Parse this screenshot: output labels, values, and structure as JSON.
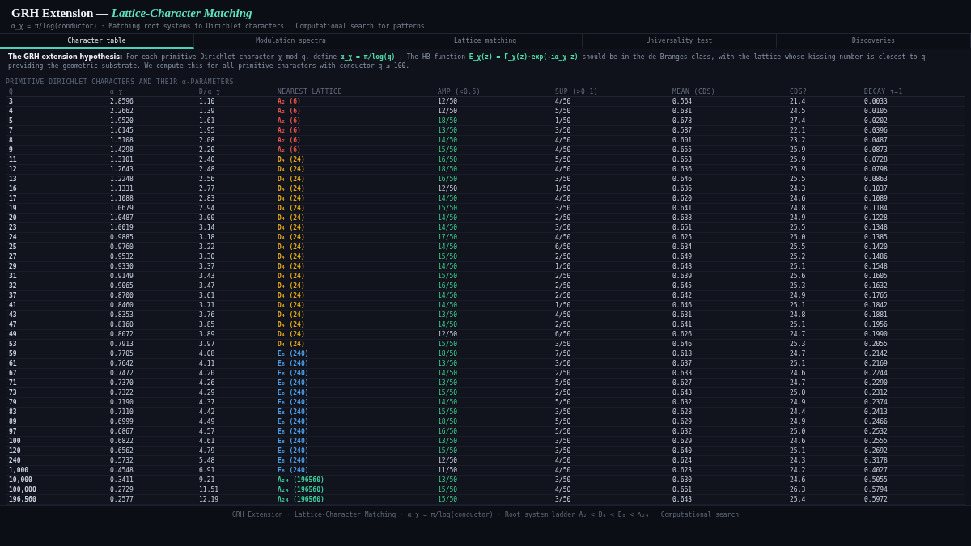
{
  "header": {
    "title": "GRH Extension — ",
    "title_em": "Lattice-Character Matching",
    "subtitle": "α_χ = π/log(conductor) · Matching root systems to Dirichlet characters · Computational search for patterns"
  },
  "tabs": [
    {
      "label": "Character table",
      "selected": true
    },
    {
      "label": "Modulation spectra",
      "selected": false
    },
    {
      "label": "Lattice matching",
      "selected": false
    },
    {
      "label": "Universality test",
      "selected": false
    },
    {
      "label": "Discoveries",
      "selected": false
    }
  ],
  "intro": [
    {
      "kind": "lead",
      "text": "The GRH extension hypothesis:"
    },
    {
      "kind": "text",
      "text": "For each primitive Dirichlet character χ mod q, define"
    },
    {
      "kind": "code",
      "text": "α_χ = π/log(q)"
    },
    {
      "kind": "text",
      "text": ". The HB function"
    },
    {
      "kind": "code",
      "text": "E_χ(z) = Γ_χ(z)·exp(-iα_χ z)"
    },
    {
      "kind": "text",
      "text": "should be in the de Branges class, with the lattice whose kissing number is closest to q providing the geometric substrate. We compute this for all primitive characters with conductor q ≤ 100."
    }
  ],
  "section_label": "PRIMITIVE DIRICHLET CHARACTERS AND THEIR α-PARAMETERS",
  "table": {
    "columns": [
      "Q",
      "α_χ",
      "D/α_χ",
      "NEAREST LATTICE",
      "AMP (<0.5)",
      "SUP (>0.1)",
      "MEAN (CDS)",
      "CDS?",
      "DECAY τ=1"
    ],
    "rows": [
      {
        "q": "3",
        "alpha": "2.8596",
        "d_alpha": "1.10",
        "lattice": {
          "symbol": "A₂",
          "kissing": "(6)",
          "color": "#e5534b"
        },
        "amp": "12/50",
        "amp_pass": false,
        "sup": "4/50",
        "mean": "0.564",
        "cds": "21.4",
        "decay": "0.0033"
      },
      {
        "q": "4",
        "alpha": "2.2662",
        "d_alpha": "1.39",
        "lattice": {
          "symbol": "A₂",
          "kissing": "(6)",
          "color": "#e5534b"
        },
        "amp": "12/50",
        "amp_pass": false,
        "sup": "5/50",
        "mean": "0.631",
        "cds": "24.5",
        "decay": "0.0105"
      },
      {
        "q": "5",
        "alpha": "1.9520",
        "d_alpha": "1.61",
        "lattice": {
          "symbol": "A₂",
          "kissing": "(6)",
          "color": "#e5534b"
        },
        "amp": "18/50",
        "amp_pass": true,
        "sup": "1/50",
        "mean": "0.678",
        "cds": "27.4",
        "decay": "0.0202"
      },
      {
        "q": "7",
        "alpha": "1.6145",
        "d_alpha": "1.95",
        "lattice": {
          "symbol": "A₂",
          "kissing": "(6)",
          "color": "#e5534b"
        },
        "amp": "13/50",
        "amp_pass": true,
        "sup": "3/50",
        "mean": "0.587",
        "cds": "22.1",
        "decay": "0.0396"
      },
      {
        "q": "8",
        "alpha": "1.5108",
        "d_alpha": "2.08",
        "lattice": {
          "symbol": "A₂",
          "kissing": "(6)",
          "color": "#e5534b"
        },
        "amp": "14/50",
        "amp_pass": true,
        "sup": "4/50",
        "mean": "0.601",
        "cds": "23.2",
        "decay": "0.0487"
      },
      {
        "q": "9",
        "alpha": "1.4298",
        "d_alpha": "2.20",
        "lattice": {
          "symbol": "A₂",
          "kissing": "(6)",
          "color": "#e5534b"
        },
        "amp": "15/50",
        "amp_pass": true,
        "sup": "4/50",
        "mean": "0.655",
        "cds": "25.9",
        "decay": "0.0873"
      },
      {
        "q": "11",
        "alpha": "1.3101",
        "d_alpha": "2.40",
        "lattice": {
          "symbol": "D₄",
          "kissing": "(24)",
          "color": "#e6a817"
        },
        "amp": "16/50",
        "amp_pass": true,
        "sup": "5/50",
        "mean": "0.653",
        "cds": "25.9",
        "decay": "0.0728"
      },
      {
        "q": "12",
        "alpha": "1.2643",
        "d_alpha": "2.48",
        "lattice": {
          "symbol": "D₄",
          "kissing": "(24)",
          "color": "#e6a817"
        },
        "amp": "18/50",
        "amp_pass": true,
        "sup": "4/50",
        "mean": "0.636",
        "cds": "25.9",
        "decay": "0.0798"
      },
      {
        "q": "13",
        "alpha": "1.2248",
        "d_alpha": "2.56",
        "lattice": {
          "symbol": "D₄",
          "kissing": "(24)",
          "color": "#e6a817"
        },
        "amp": "16/50",
        "amp_pass": true,
        "sup": "3/50",
        "mean": "0.646",
        "cds": "25.5",
        "decay": "0.0863"
      },
      {
        "q": "16",
        "alpha": "1.1331",
        "d_alpha": "2.77",
        "lattice": {
          "symbol": "D₄",
          "kissing": "(24)",
          "color": "#e6a817"
        },
        "amp": "12/50",
        "amp_pass": false,
        "sup": "1/50",
        "mean": "0.636",
        "cds": "24.3",
        "decay": "0.1037"
      },
      {
        "q": "17",
        "alpha": "1.1088",
        "d_alpha": "2.83",
        "lattice": {
          "symbol": "D₄",
          "kissing": "(24)",
          "color": "#e6a817"
        },
        "amp": "14/50",
        "amp_pass": true,
        "sup": "4/50",
        "mean": "0.620",
        "cds": "24.6",
        "decay": "0.1089"
      },
      {
        "q": "19",
        "alpha": "1.0679",
        "d_alpha": "2.94",
        "lattice": {
          "symbol": "D₄",
          "kissing": "(24)",
          "color": "#e6a817"
        },
        "amp": "15/50",
        "amp_pass": true,
        "sup": "3/50",
        "mean": "0.641",
        "cds": "24.8",
        "decay": "0.1184"
      },
      {
        "q": "20",
        "alpha": "1.0487",
        "d_alpha": "3.00",
        "lattice": {
          "symbol": "D₄",
          "kissing": "(24)",
          "color": "#e6a817"
        },
        "amp": "14/50",
        "amp_pass": true,
        "sup": "2/50",
        "mean": "0.638",
        "cds": "24.9",
        "decay": "0.1228"
      },
      {
        "q": "23",
        "alpha": "1.0019",
        "d_alpha": "3.14",
        "lattice": {
          "symbol": "D₄",
          "kissing": "(24)",
          "color": "#e6a817"
        },
        "amp": "14/50",
        "amp_pass": true,
        "sup": "3/50",
        "mean": "0.651",
        "cds": "25.5",
        "decay": "0.1348"
      },
      {
        "q": "24",
        "alpha": "0.9885",
        "d_alpha": "3.18",
        "lattice": {
          "symbol": "D₄",
          "kissing": "(24)",
          "color": "#e6a817"
        },
        "amp": "17/50",
        "amp_pass": true,
        "sup": "4/50",
        "mean": "0.625",
        "cds": "25.0",
        "decay": "0.1385"
      },
      {
        "q": "25",
        "alpha": "0.9760",
        "d_alpha": "3.22",
        "lattice": {
          "symbol": "D₄",
          "kissing": "(24)",
          "color": "#e6a817"
        },
        "amp": "14/50",
        "amp_pass": true,
        "sup": "6/50",
        "mean": "0.634",
        "cds": "25.5",
        "decay": "0.1420"
      },
      {
        "q": "27",
        "alpha": "0.9532",
        "d_alpha": "3.30",
        "lattice": {
          "symbol": "D₄",
          "kissing": "(24)",
          "color": "#e6a817"
        },
        "amp": "15/50",
        "amp_pass": true,
        "sup": "2/50",
        "mean": "0.649",
        "cds": "25.2",
        "decay": "0.1486"
      },
      {
        "q": "29",
        "alpha": "0.9330",
        "d_alpha": "3.37",
        "lattice": {
          "symbol": "D₄",
          "kissing": "(24)",
          "color": "#e6a817"
        },
        "amp": "14/50",
        "amp_pass": true,
        "sup": "1/50",
        "mean": "0.648",
        "cds": "25.1",
        "decay": "0.1548"
      },
      {
        "q": "31",
        "alpha": "0.9149",
        "d_alpha": "3.43",
        "lattice": {
          "symbol": "D₄",
          "kissing": "(24)",
          "color": "#e6a817"
        },
        "amp": "15/50",
        "amp_pass": true,
        "sup": "2/50",
        "mean": "0.639",
        "cds": "25.6",
        "decay": "0.1605"
      },
      {
        "q": "32",
        "alpha": "0.9065",
        "d_alpha": "3.47",
        "lattice": {
          "symbol": "D₄",
          "kissing": "(24)",
          "color": "#e6a817"
        },
        "amp": "16/50",
        "amp_pass": true,
        "sup": "2/50",
        "mean": "0.645",
        "cds": "25.3",
        "decay": "0.1632"
      },
      {
        "q": "37",
        "alpha": "0.8700",
        "d_alpha": "3.61",
        "lattice": {
          "symbol": "D₄",
          "kissing": "(24)",
          "color": "#e6a817"
        },
        "amp": "14/50",
        "amp_pass": true,
        "sup": "2/50",
        "mean": "0.642",
        "cds": "24.9",
        "decay": "0.1765"
      },
      {
        "q": "41",
        "alpha": "0.8460",
        "d_alpha": "3.71",
        "lattice": {
          "symbol": "D₄",
          "kissing": "(24)",
          "color": "#e6a817"
        },
        "amp": "14/50",
        "amp_pass": true,
        "sup": "1/50",
        "mean": "0.646",
        "cds": "25.1",
        "decay": "0.1842"
      },
      {
        "q": "43",
        "alpha": "0.8353",
        "d_alpha": "3.76",
        "lattice": {
          "symbol": "D₄",
          "kissing": "(24)",
          "color": "#e6a817"
        },
        "amp": "13/50",
        "amp_pass": true,
        "sup": "4/50",
        "mean": "0.631",
        "cds": "24.8",
        "decay": "0.1881"
      },
      {
        "q": "47",
        "alpha": "0.8160",
        "d_alpha": "3.85",
        "lattice": {
          "symbol": "D₄",
          "kissing": "(24)",
          "color": "#e6a817"
        },
        "amp": "14/50",
        "amp_pass": true,
        "sup": "2/50",
        "mean": "0.641",
        "cds": "25.1",
        "decay": "0.1956"
      },
      {
        "q": "49",
        "alpha": "0.8072",
        "d_alpha": "3.89",
        "lattice": {
          "symbol": "D₄",
          "kissing": "(24)",
          "color": "#e6a817"
        },
        "amp": "12/50",
        "amp_pass": false,
        "sup": "6/50",
        "mean": "0.626",
        "cds": "24.7",
        "decay": "0.1990"
      },
      {
        "q": "53",
        "alpha": "0.7913",
        "d_alpha": "3.97",
        "lattice": {
          "symbol": "D₄",
          "kissing": "(24)",
          "color": "#e6a817"
        },
        "amp": "15/50",
        "amp_pass": true,
        "sup": "3/50",
        "mean": "0.646",
        "cds": "25.3",
        "decay": "0.2055"
      },
      {
        "q": "59",
        "alpha": "0.7705",
        "d_alpha": "4.08",
        "lattice": {
          "symbol": "E₈",
          "kissing": "(240)",
          "color": "#4f9ee8"
        },
        "amp": "18/50",
        "amp_pass": true,
        "sup": "7/50",
        "mean": "0.618",
        "cds": "24.7",
        "decay": "0.2142"
      },
      {
        "q": "61",
        "alpha": "0.7642",
        "d_alpha": "4.11",
        "lattice": {
          "symbol": "E₈",
          "kissing": "(240)",
          "color": "#4f9ee8"
        },
        "amp": "13/50",
        "amp_pass": true,
        "sup": "3/50",
        "mean": "0.637",
        "cds": "25.1",
        "decay": "0.2169"
      },
      {
        "q": "67",
        "alpha": "0.7472",
        "d_alpha": "4.20",
        "lattice": {
          "symbol": "E₈",
          "kissing": "(240)",
          "color": "#4f9ee8"
        },
        "amp": "14/50",
        "amp_pass": true,
        "sup": "2/50",
        "mean": "0.633",
        "cds": "24.6",
        "decay": "0.2244"
      },
      {
        "q": "71",
        "alpha": "0.7370",
        "d_alpha": "4.26",
        "lattice": {
          "symbol": "E₈",
          "kissing": "(240)",
          "color": "#4f9ee8"
        },
        "amp": "13/50",
        "amp_pass": true,
        "sup": "5/50",
        "mean": "0.627",
        "cds": "24.7",
        "decay": "0.2290"
      },
      {
        "q": "73",
        "alpha": "0.7322",
        "d_alpha": "4.29",
        "lattice": {
          "symbol": "E₈",
          "kissing": "(240)",
          "color": "#4f9ee8"
        },
        "amp": "15/50",
        "amp_pass": true,
        "sup": "2/50",
        "mean": "0.643",
        "cds": "25.0",
        "decay": "0.2312"
      },
      {
        "q": "79",
        "alpha": "0.7190",
        "d_alpha": "4.37",
        "lattice": {
          "symbol": "E₈",
          "kissing": "(240)",
          "color": "#4f9ee8"
        },
        "amp": "14/50",
        "amp_pass": true,
        "sup": "5/50",
        "mean": "0.632",
        "cds": "24.9",
        "decay": "0.2374"
      },
      {
        "q": "83",
        "alpha": "0.7110",
        "d_alpha": "4.42",
        "lattice": {
          "symbol": "E₈",
          "kissing": "(240)",
          "color": "#4f9ee8"
        },
        "amp": "15/50",
        "amp_pass": true,
        "sup": "3/50",
        "mean": "0.628",
        "cds": "24.4",
        "decay": "0.2413"
      },
      {
        "q": "89",
        "alpha": "0.6999",
        "d_alpha": "4.49",
        "lattice": {
          "symbol": "E₈",
          "kissing": "(240)",
          "color": "#4f9ee8"
        },
        "amp": "18/50",
        "amp_pass": true,
        "sup": "5/50",
        "mean": "0.629",
        "cds": "24.9",
        "decay": "0.2466"
      },
      {
        "q": "97",
        "alpha": "0.6867",
        "d_alpha": "4.57",
        "lattice": {
          "symbol": "E₈",
          "kissing": "(240)",
          "color": "#4f9ee8"
        },
        "amp": "16/50",
        "amp_pass": true,
        "sup": "5/50",
        "mean": "0.632",
        "cds": "25.0",
        "decay": "0.2532"
      },
      {
        "q": "100",
        "alpha": "0.6822",
        "d_alpha": "4.61",
        "lattice": {
          "symbol": "E₈",
          "kissing": "(240)",
          "color": "#4f9ee8"
        },
        "amp": "13/50",
        "amp_pass": true,
        "sup": "3/50",
        "mean": "0.629",
        "cds": "24.6",
        "decay": "0.2555"
      },
      {
        "q": "120",
        "alpha": "0.6562",
        "d_alpha": "4.79",
        "lattice": {
          "symbol": "E₈",
          "kissing": "(240)",
          "color": "#4f9ee8"
        },
        "amp": "15/50",
        "amp_pass": true,
        "sup": "3/50",
        "mean": "0.640",
        "cds": "25.1",
        "decay": "0.2692"
      },
      {
        "q": "240",
        "alpha": "0.5732",
        "d_alpha": "5.48",
        "lattice": {
          "symbol": "E₈",
          "kissing": "(240)",
          "color": "#4f9ee8"
        },
        "amp": "12/50",
        "amp_pass": false,
        "sup": "4/50",
        "mean": "0.624",
        "cds": "24.3",
        "decay": "0.3178"
      },
      {
        "q": "1,000",
        "alpha": "0.4548",
        "d_alpha": "6.91",
        "lattice": {
          "symbol": "E₈",
          "kissing": "(240)",
          "color": "#4f9ee8"
        },
        "amp": "11/50",
        "amp_pass": false,
        "sup": "4/50",
        "mean": "0.623",
        "cds": "24.2",
        "decay": "0.4027"
      },
      {
        "q": "10,000",
        "alpha": "0.3411",
        "d_alpha": "9.21",
        "lattice": {
          "symbol": "Λ₂₄",
          "kissing": "(196560)",
          "color": "#3ecf9e"
        },
        "amp": "13/50",
        "amp_pass": true,
        "sup": "3/50",
        "mean": "0.630",
        "cds": "24.6",
        "decay": "0.5055"
      },
      {
        "q": "100,000",
        "alpha": "0.2729",
        "d_alpha": "11.51",
        "lattice": {
          "symbol": "Λ₂₄",
          "kissing": "(196560)",
          "color": "#3ecf9e"
        },
        "amp": "15/50",
        "amp_pass": true,
        "sup": "4/50",
        "mean": "0.661",
        "cds": "26.3",
        "decay": "0.5794"
      },
      {
        "q": "196,560",
        "alpha": "0.2577",
        "d_alpha": "12.19",
        "lattice": {
          "symbol": "Λ₂₄",
          "kissing": "(196560)",
          "color": "#3ecf9e"
        },
        "amp": "15/50",
        "amp_pass": true,
        "sup": "3/50",
        "mean": "0.643",
        "cds": "25.4",
        "decay": "0.5972"
      }
    ]
  },
  "footer": "GRH Extension · Lattice-Character Matching · α_χ = π/log(conductor) · Root system ladder A₂ < D₄ < E₈ < Λ₂₄ · Computational search"
}
